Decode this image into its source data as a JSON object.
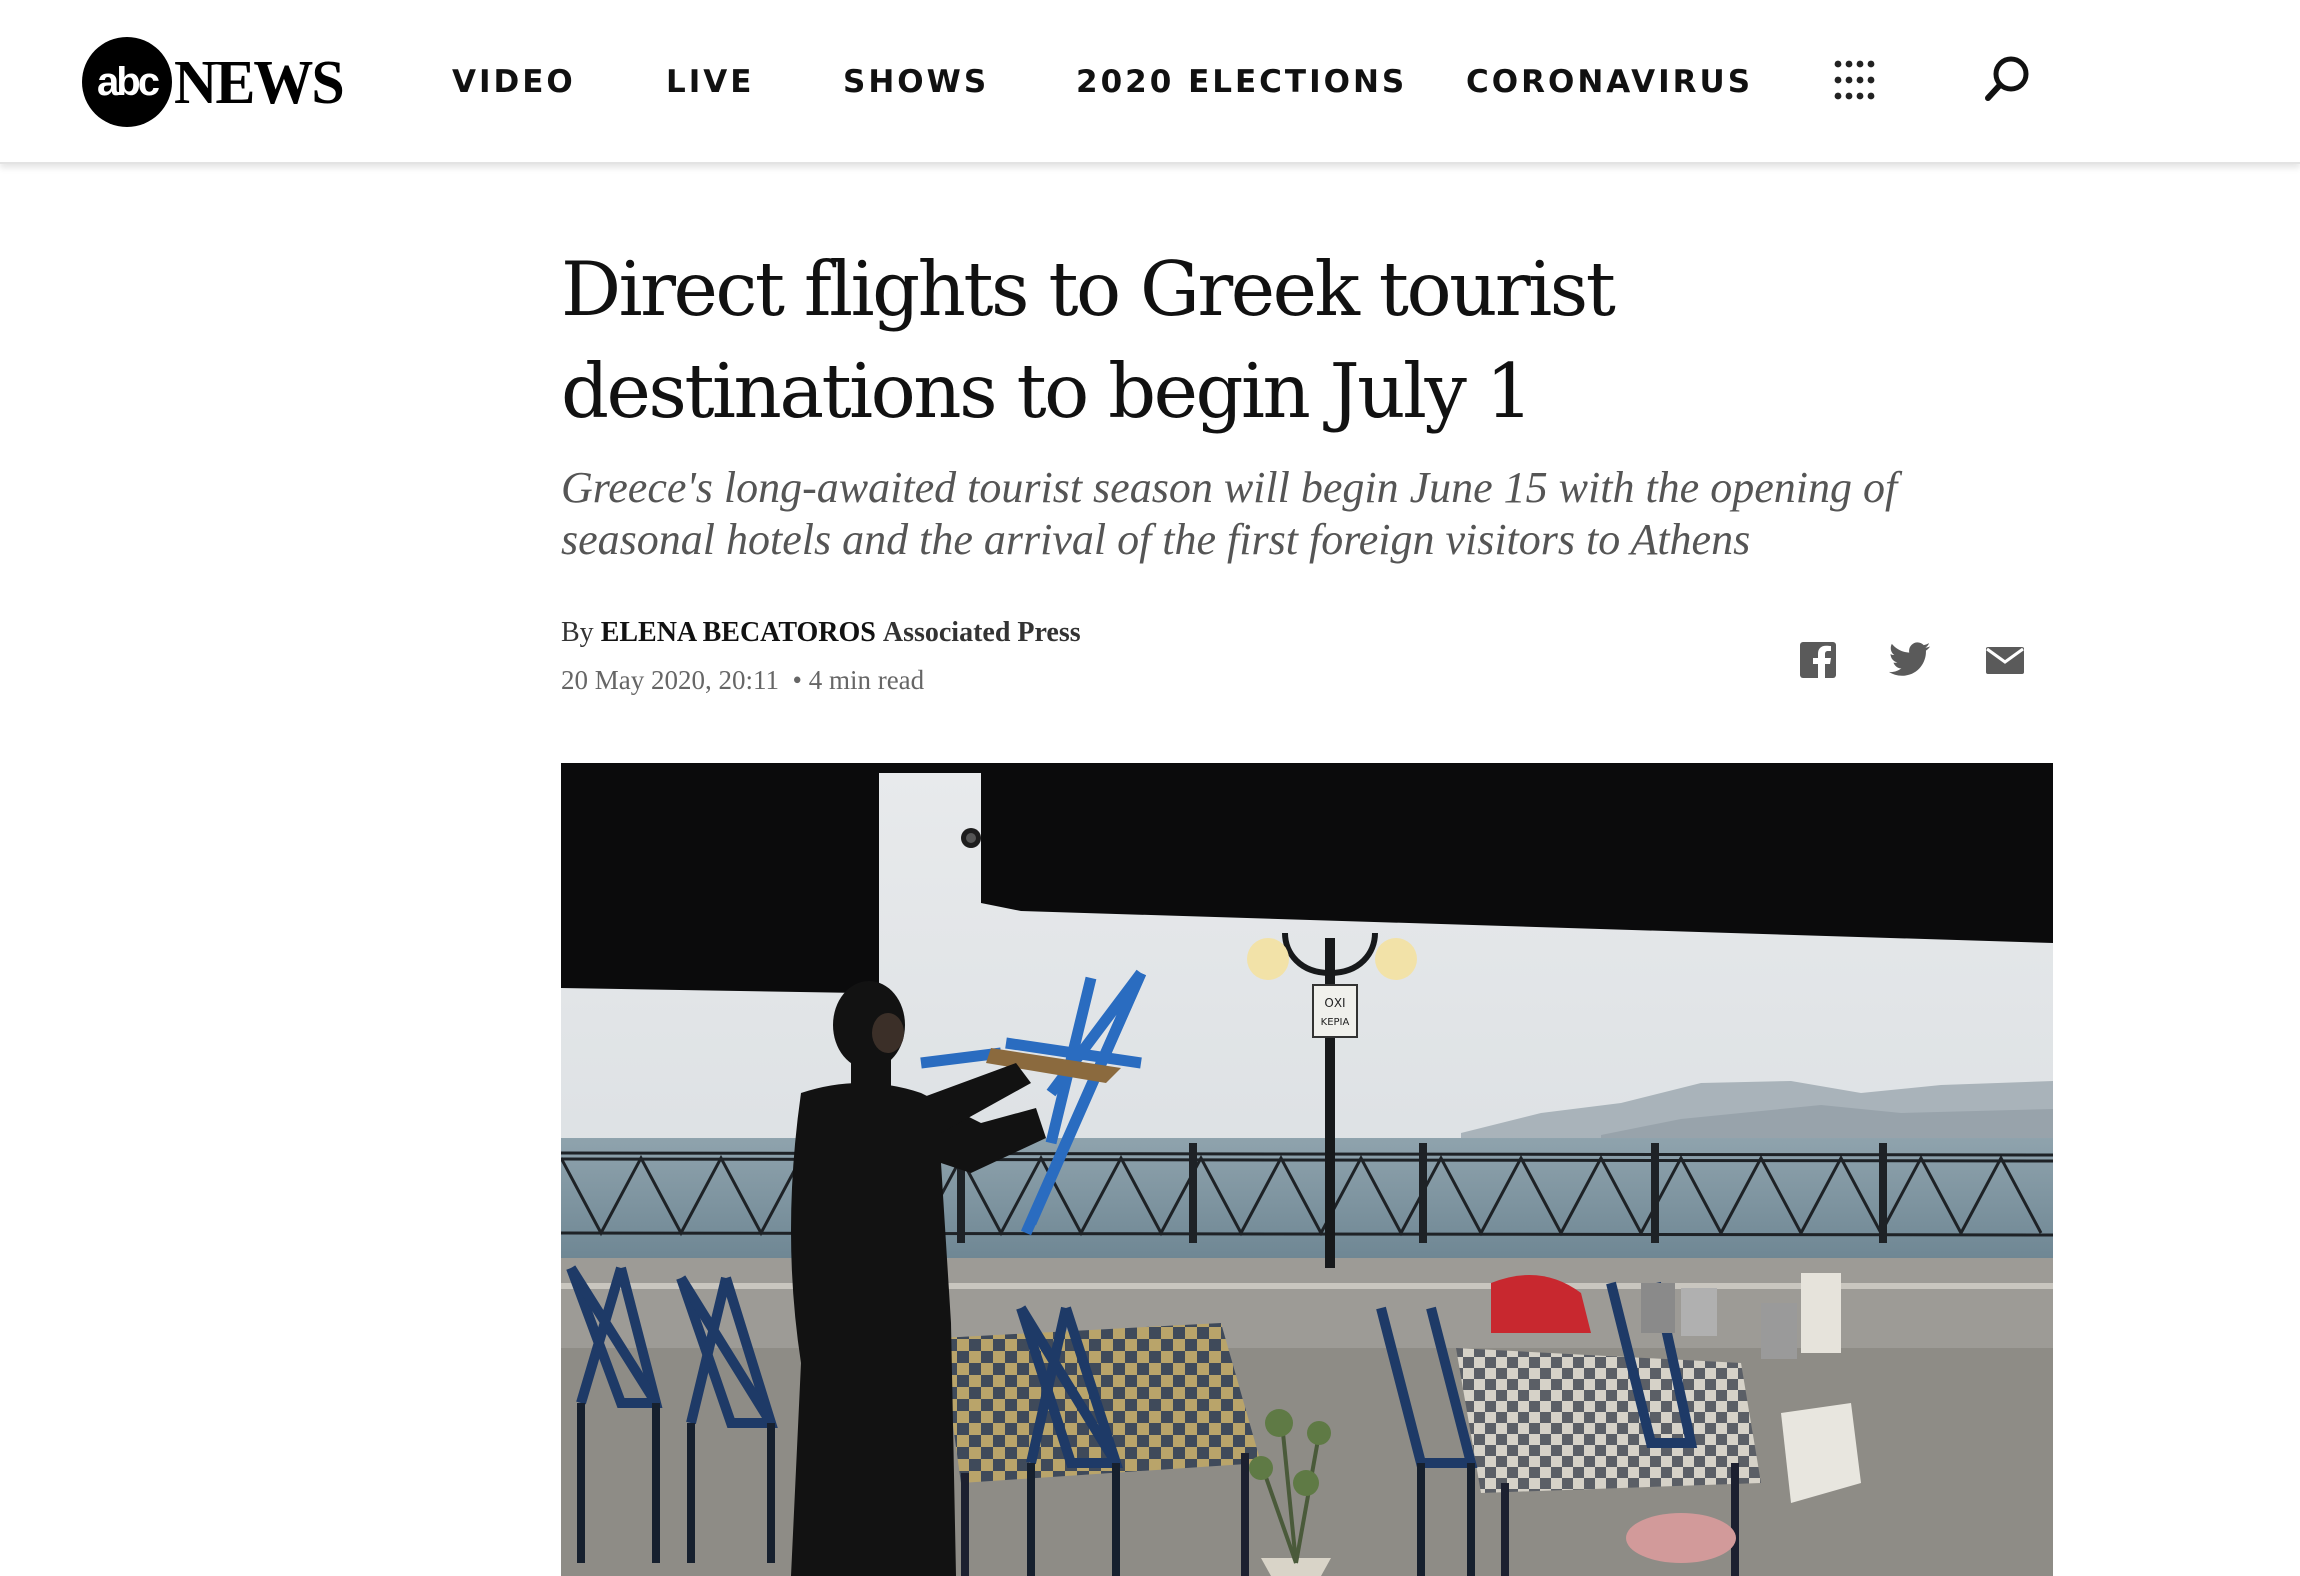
{
  "brand": {
    "logo_mark": "abc",
    "logo_word": "NEWS"
  },
  "nav": {
    "items": [
      {
        "label": "VIDEO"
      },
      {
        "label": "LIVE"
      },
      {
        "label": "SHOWS"
      },
      {
        "label": "2020 ELECTIONS"
      },
      {
        "label": "CORONAVIRUS"
      }
    ],
    "menu_icon": "grid-menu-icon",
    "search_icon": "search-icon"
  },
  "article": {
    "headline_line1": "Direct flights to Greek tourist",
    "headline_line2": "destinations to begin July 1",
    "subheadline": "Greece's long-awaited tourist season will begin June 15 with the opening of seasonal hotels and the arrival of the first foreign visitors to Athens",
    "byline_prefix": "By",
    "author": "ELENA BECATOROS",
    "organization": "Associated Press",
    "date": "20 May 2020, 20:11",
    "read_time": "• 4 min read",
    "share": [
      {
        "icon": "facebook-icon"
      },
      {
        "icon": "twitter-icon"
      },
      {
        "icon": "email-icon"
      }
    ],
    "photo_sign_text": "ΟΧΙ ΚΕΡΙΑ"
  },
  "colors": {
    "text": "#111111",
    "subhead": "#555555",
    "meta": "#666666",
    "icon": "#555555"
  }
}
